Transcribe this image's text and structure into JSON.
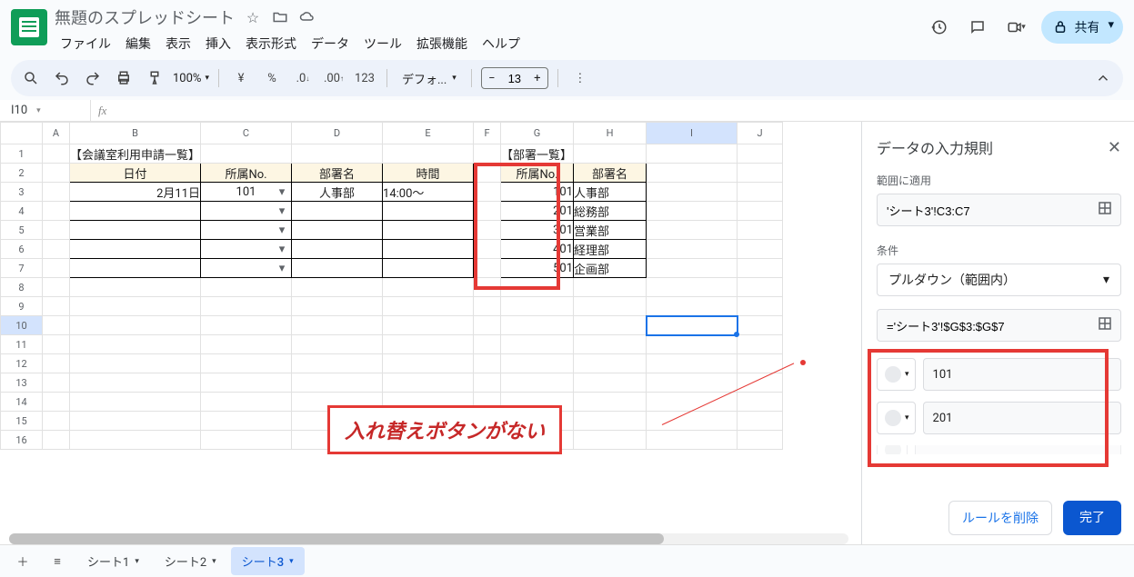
{
  "doc": {
    "title": "無題のスプレッドシート"
  },
  "menus": {
    "file": "ファイル",
    "edit": "編集",
    "view": "表示",
    "insert": "挿入",
    "format": "表示形式",
    "data": "データ",
    "tools": "ツール",
    "ext": "拡張機能",
    "help": "ヘルプ"
  },
  "share": {
    "label": "共有"
  },
  "toolbar": {
    "zoom": "100%",
    "font": "デフォ...",
    "size": "13"
  },
  "namebox": {
    "value": "I10"
  },
  "sheet": {
    "cols": [
      "A",
      "B",
      "C",
      "D",
      "E",
      "F",
      "G",
      "H",
      "I",
      "J"
    ],
    "rows": [
      "1",
      "2",
      "3",
      "4",
      "5",
      "6",
      "7",
      "8",
      "9",
      "10",
      "11",
      "12",
      "13",
      "14",
      "15",
      "16"
    ],
    "label1": "【会議室利用申請一覧】",
    "label2": "【部署一覧】",
    "hdrs": {
      "b": "日付",
      "c": "所属No.",
      "d": "部署名",
      "e": "時間",
      "g": "所属No.",
      "h": "部署名"
    },
    "row3": {
      "b": "2月11日",
      "c": "101",
      "d": "人事部",
      "e": "14:00～"
    },
    "depts": [
      {
        "no": "101",
        "name": "人事部"
      },
      {
        "no": "201",
        "name": "総務部"
      },
      {
        "no": "301",
        "name": "営業部"
      },
      {
        "no": "401",
        "name": "経理部"
      },
      {
        "no": "501",
        "name": "企画部"
      }
    ]
  },
  "annot": {
    "text": "入れ替えボタンがない"
  },
  "panel": {
    "title": "データの入力規則",
    "range_label": "範囲に適用",
    "range_value": "'シート3'!C3:C7",
    "cond_label": "条件",
    "cond_value": "プルダウン（範囲内）",
    "formula": "='シート3'!$G$3:$G$7",
    "opt1": "101",
    "opt2": "201",
    "delete": "ルールを削除",
    "done": "完了"
  },
  "tabs": {
    "s1": "シート1",
    "s2": "シート2",
    "s3": "シート3"
  }
}
